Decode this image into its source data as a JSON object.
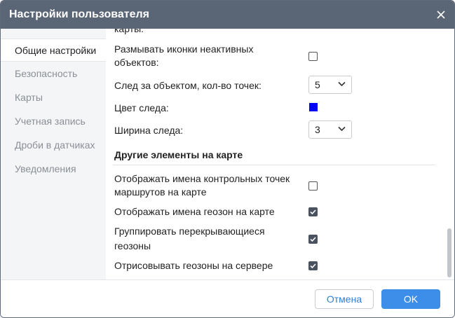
{
  "dialog": {
    "title": "Настройки пользователя"
  },
  "sidebar": {
    "items": [
      {
        "label": "Общие настройки",
        "active": true
      },
      {
        "label": "Безопасность"
      },
      {
        "label": "Карты"
      },
      {
        "label": "Учетная запись"
      },
      {
        "label": "Дроби в датчиках"
      },
      {
        "label": "Уведомления"
      }
    ]
  },
  "content": {
    "cut_label": "карты:",
    "blur_icons": {
      "label_line1": "Размывать иконки неактивных",
      "label_line2": "объектов:",
      "checked": false
    },
    "trail_points": {
      "label": "След за объектом, кол-во точек:",
      "value": "5"
    },
    "trail_color": {
      "label": "Цвет следа:",
      "color": "#0000ff"
    },
    "trail_width": {
      "label": "Ширина следа:",
      "value": "3"
    },
    "section_other": "Другие элементы на карте",
    "checkpoint_names": {
      "label_line1": "Отображать имена контрольных точек",
      "label_line2": "маршрутов на карте",
      "checked": false
    },
    "geofence_names": {
      "label": "Отображать имена геозон на карте",
      "checked": true
    },
    "group_geofences": {
      "label_line1": "Группировать перекрывающиеся",
      "label_line2": "геозоны",
      "checked": true
    },
    "server_geofences": {
      "label": "Отрисовывать геозоны на сервере",
      "checked": true
    }
  },
  "footer": {
    "cancel_label": "Отмена",
    "ok_label": "OK"
  },
  "colors": {
    "titlebar": "#5a6575",
    "accent": "#3d8ee8"
  }
}
